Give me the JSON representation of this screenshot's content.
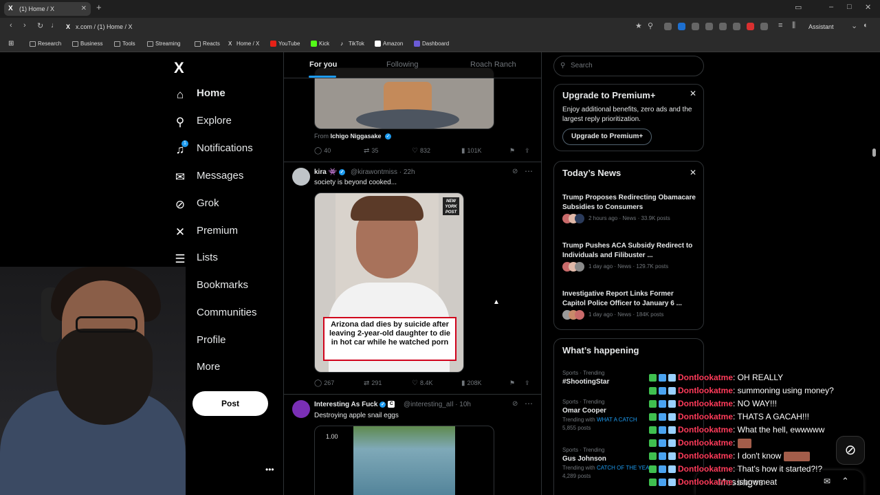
{
  "browser": {
    "tab_title": "(1) Home / X",
    "tab_favicon": "X",
    "url": "x.com / (1) Home / X",
    "assistant_label": "Assistant",
    "bookmarks": [
      {
        "label": "Research",
        "icon": "folder-icon"
      },
      {
        "label": "Business",
        "icon": "folder-icon"
      },
      {
        "label": "Tools",
        "icon": "folder-icon"
      },
      {
        "label": "Streaming",
        "icon": "folder-icon"
      },
      {
        "label": "Reacts",
        "icon": "folder-icon"
      },
      {
        "label": "Home / X",
        "icon": "x-icon"
      },
      {
        "label": "YouTube",
        "icon": "youtube-icon"
      },
      {
        "label": "Kick",
        "icon": "kick-icon"
      },
      {
        "label": "TikTok",
        "icon": "tiktok-icon"
      },
      {
        "label": "Amazon",
        "icon": "amazon-icon"
      },
      {
        "label": "Dashboard",
        "icon": "dashboard-icon"
      }
    ]
  },
  "sidebar": {
    "logo": "X",
    "items": [
      {
        "label": "Home",
        "icon": "home-icon"
      },
      {
        "label": "Explore",
        "icon": "search-icon"
      },
      {
        "label": "Notifications",
        "icon": "bell-icon"
      },
      {
        "label": "Messages",
        "icon": "mail-icon"
      },
      {
        "label": "Grok",
        "icon": "grok-icon"
      },
      {
        "label": "Premium",
        "icon": "x-icon"
      },
      {
        "label": "Lists",
        "icon": "list-icon"
      },
      {
        "label": "Bookmarks",
        "icon": "bookmark-icon"
      },
      {
        "label": "Communities",
        "icon": "people-icon"
      },
      {
        "label": "Profile",
        "icon": "person-icon"
      },
      {
        "label": "More",
        "icon": "more-icon"
      }
    ],
    "post_button": "Post",
    "notification_badge": "1"
  },
  "feed": {
    "tabs": [
      "For you",
      "Following",
      "Roach Ranch"
    ],
    "post0": {
      "from_label": "From",
      "from_user": "Ichigo Niggasake",
      "replies": "40",
      "reposts": "35",
      "likes": "832",
      "views": "101K"
    },
    "post1": {
      "name": "kira 👾",
      "handle": "@kirawontmiss",
      "time": "· 22h",
      "text": "society is beyond cooked...",
      "media_caption": "Arizona dad dies by suicide after leaving 2-year-old daughter to die in hot car while he watched porn",
      "media_logo": "NEW YORK POST",
      "replies": "267",
      "reposts": "291",
      "likes": "8.4K",
      "views": "208K"
    },
    "post2": {
      "name": "Interesting As Fuck",
      "handle": "@interesting_aIl",
      "time": "· 10h",
      "text": "Destroying apple snail eggs",
      "media_label": "1.00"
    }
  },
  "right": {
    "search_placeholder": "Search",
    "premium": {
      "title": "Upgrade to Premium+",
      "body": "Enjoy additional benefits, zero ads and the largest reply prioritization.",
      "button": "Upgrade to Premium+"
    },
    "news": {
      "title": "Today’s News",
      "items": [
        {
          "headline": "Trump Proposes Redirecting Obamacare Subsidies to Consumers",
          "meta": "2 hours ago · News · 33.9K posts"
        },
        {
          "headline": "Trump Pushes ACA Subsidy Redirect to Individuals and Filibuster ...",
          "meta": "1 day ago · News · 129.7K posts"
        },
        {
          "headline": "Investigative Report Links Former Capitol Police Officer to January 6 ...",
          "meta": "1 day ago · News · 184K posts"
        }
      ]
    },
    "happening": {
      "title": "What’s happening",
      "trends": [
        {
          "category": "Sports · Trending",
          "name": "#ShootingStar",
          "with_label": "",
          "with_value": "",
          "posts": ""
        },
        {
          "category": "Sports · Trending",
          "name": "Omar Cooper",
          "with_label": "Trending with",
          "with_value": "WHAT A CATCH",
          "posts": "5,855 posts"
        },
        {
          "category": "Sports · Trending",
          "name": "Gus Johnson",
          "with_label": "Trending with",
          "with_value": "CATCH OF THE YEAR",
          "posts": "4,289 posts"
        }
      ]
    }
  },
  "chat": {
    "user": "Dontlookatme",
    "messages": [
      {
        "text": ": OH REALLY",
        "emote": ""
      },
      {
        "text": ": summoning using money?",
        "emote": ""
      },
      {
        "text": ": NO WAY!!!",
        "emote": ""
      },
      {
        "text": ": THATS A GACAH!!!",
        "emote": ""
      },
      {
        "text": ": What the hell, ewwwww",
        "emote": ""
      },
      {
        "text": ":",
        "emote": "small"
      },
      {
        "text": ": I don't know",
        "emote": "wide"
      },
      {
        "text": ": That's how it started?!?",
        "emote": ""
      },
      {
        "text": ": ishowmeat",
        "emote": ""
      }
    ]
  },
  "messages_drawer": {
    "label": "Messages"
  },
  "colors": {
    "accent": "#1d9bf0",
    "chat_user": "#ff3b5a",
    "background": "#000000"
  }
}
